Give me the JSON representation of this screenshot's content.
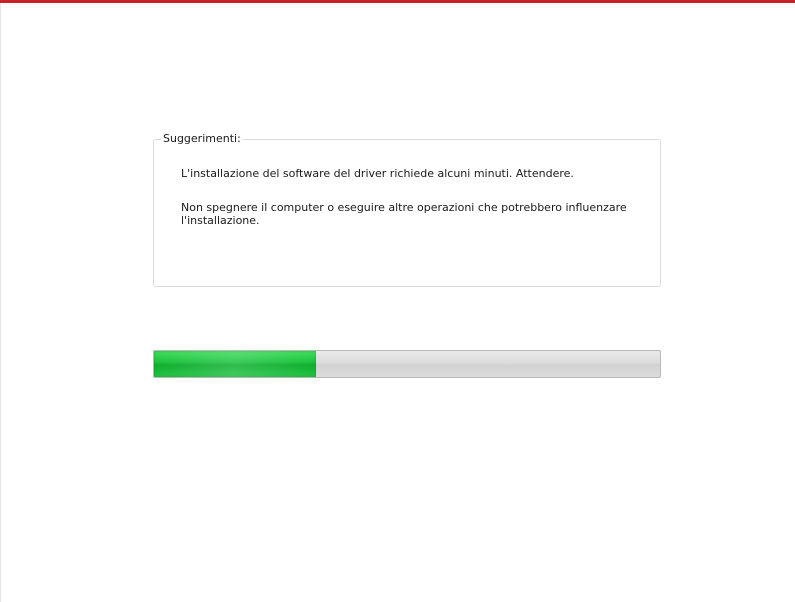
{
  "colors": {
    "accent": "#c8202a",
    "progress_fill": "#1fc440",
    "progress_track": "#dcdcdc",
    "group_border": "#d9dde3"
  },
  "tips": {
    "legend": "Suggerimenti:",
    "line1": "L'installazione del software del driver richiede alcuni minuti. Attendere.",
    "line2": "Non spegnere il computer o eseguire altre operazioni che potrebbero influenzare l'installazione."
  },
  "progress": {
    "fraction": 0.32
  }
}
